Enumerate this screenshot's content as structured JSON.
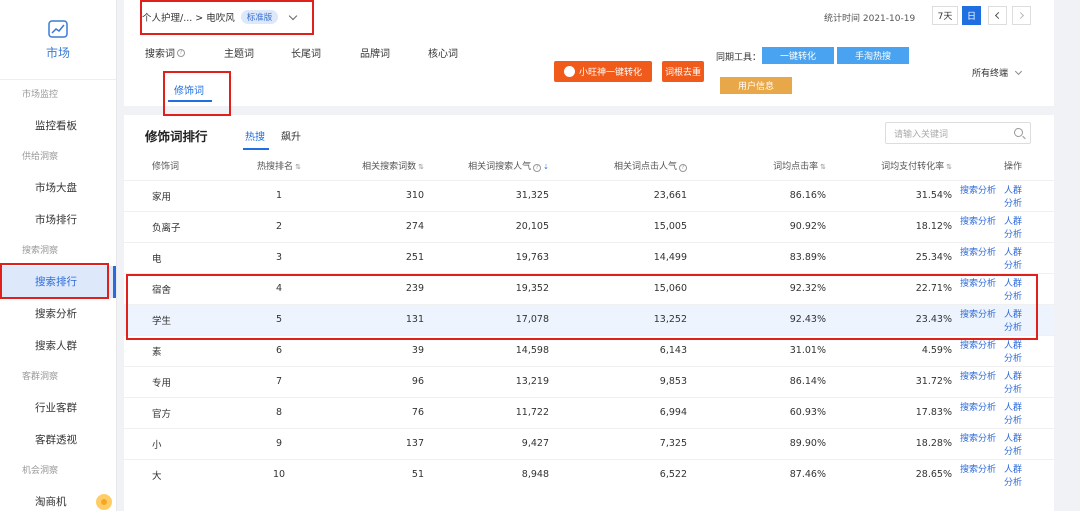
{
  "sidebar": {
    "brand_label": "市场",
    "sections": [
      {
        "title": "市场监控",
        "items": [
          "监控看板"
        ]
      },
      {
        "title": "供给洞察",
        "items": [
          "市场大盘",
          "市场排行"
        ]
      },
      {
        "title": "搜索洞察",
        "items": [
          "搜索排行",
          "搜索分析",
          "搜索人群"
        ]
      },
      {
        "title": "客群洞察",
        "items": [
          "行业客群",
          "客群透视"
        ]
      },
      {
        "title": "机会洞察",
        "items": [
          "淘商机"
        ]
      }
    ],
    "active_item": "搜索排行"
  },
  "header": {
    "breadcrumb": "个人护理/... > 电吹风",
    "edition_badge": "标准版",
    "stat_date": "统计时间 2021-10-19",
    "period_7d": "7天",
    "period_day": "日",
    "word_tabs": [
      "搜索词",
      "主题词",
      "长尾词",
      "品牌词",
      "核心词"
    ],
    "active_word_tab": "修饰词",
    "tool_buttons": {
      "xiaowang": "小旺神一键转化",
      "ciqu": "词根去重",
      "tools_label": "同期工具：",
      "yijian": "一键转化",
      "shoutao": "手淘热搜",
      "user_info": "用户信息"
    },
    "terminal_select": "所有终端"
  },
  "panel": {
    "title": "修饰词排行",
    "sub_tabs": [
      "热搜",
      "飙升"
    ],
    "search_placeholder": "请输入关键词",
    "columns": [
      "修饰词",
      "热搜排名",
      "相关搜索词数",
      "相关词搜索人气",
      "相关词点击人气",
      "词均点击率",
      "词均支付转化率",
      "操作"
    ],
    "op_labels": [
      "搜索分析",
      "人群分析"
    ],
    "rows": [
      {
        "word": "家用",
        "rank": "1",
        "count": "310",
        "search_pop": "31,325",
        "click_pop": "23,661",
        "ctr": "86.16%",
        "cvr": "31.54%"
      },
      {
        "word": "负离子",
        "rank": "2",
        "count": "274",
        "search_pop": "20,105",
        "click_pop": "15,005",
        "ctr": "90.92%",
        "cvr": "18.12%"
      },
      {
        "word": "电",
        "rank": "3",
        "count": "251",
        "search_pop": "19,763",
        "click_pop": "14,499",
        "ctr": "83.89%",
        "cvr": "25.34%"
      },
      {
        "word": "宿舍",
        "rank": "4",
        "count": "239",
        "search_pop": "19,352",
        "click_pop": "15,060",
        "ctr": "92.32%",
        "cvr": "22.71%"
      },
      {
        "word": "学生",
        "rank": "5",
        "count": "131",
        "search_pop": "17,078",
        "click_pop": "13,252",
        "ctr": "92.43%",
        "cvr": "23.43%"
      },
      {
        "word": "素",
        "rank": "6",
        "count": "39",
        "search_pop": "14,598",
        "click_pop": "6,143",
        "ctr": "31.01%",
        "cvr": "4.59%"
      },
      {
        "word": "专用",
        "rank": "7",
        "count": "96",
        "search_pop": "13,219",
        "click_pop": "9,853",
        "ctr": "86.14%",
        "cvr": "31.72%"
      },
      {
        "word": "官方",
        "rank": "8",
        "count": "76",
        "search_pop": "11,722",
        "click_pop": "6,994",
        "ctr": "60.93%",
        "cvr": "17.83%"
      },
      {
        "word": "小",
        "rank": "9",
        "count": "137",
        "search_pop": "9,427",
        "click_pop": "7,325",
        "ctr": "89.90%",
        "cvr": "18.28%"
      },
      {
        "word": "大",
        "rank": "10",
        "count": "51",
        "search_pop": "8,948",
        "click_pop": "6,522",
        "ctr": "87.46%",
        "cvr": "28.65%"
      }
    ]
  },
  "colors": {
    "accent": "#1f6fe0",
    "highlight": "#e0201a",
    "orange": "#f05a1a"
  }
}
